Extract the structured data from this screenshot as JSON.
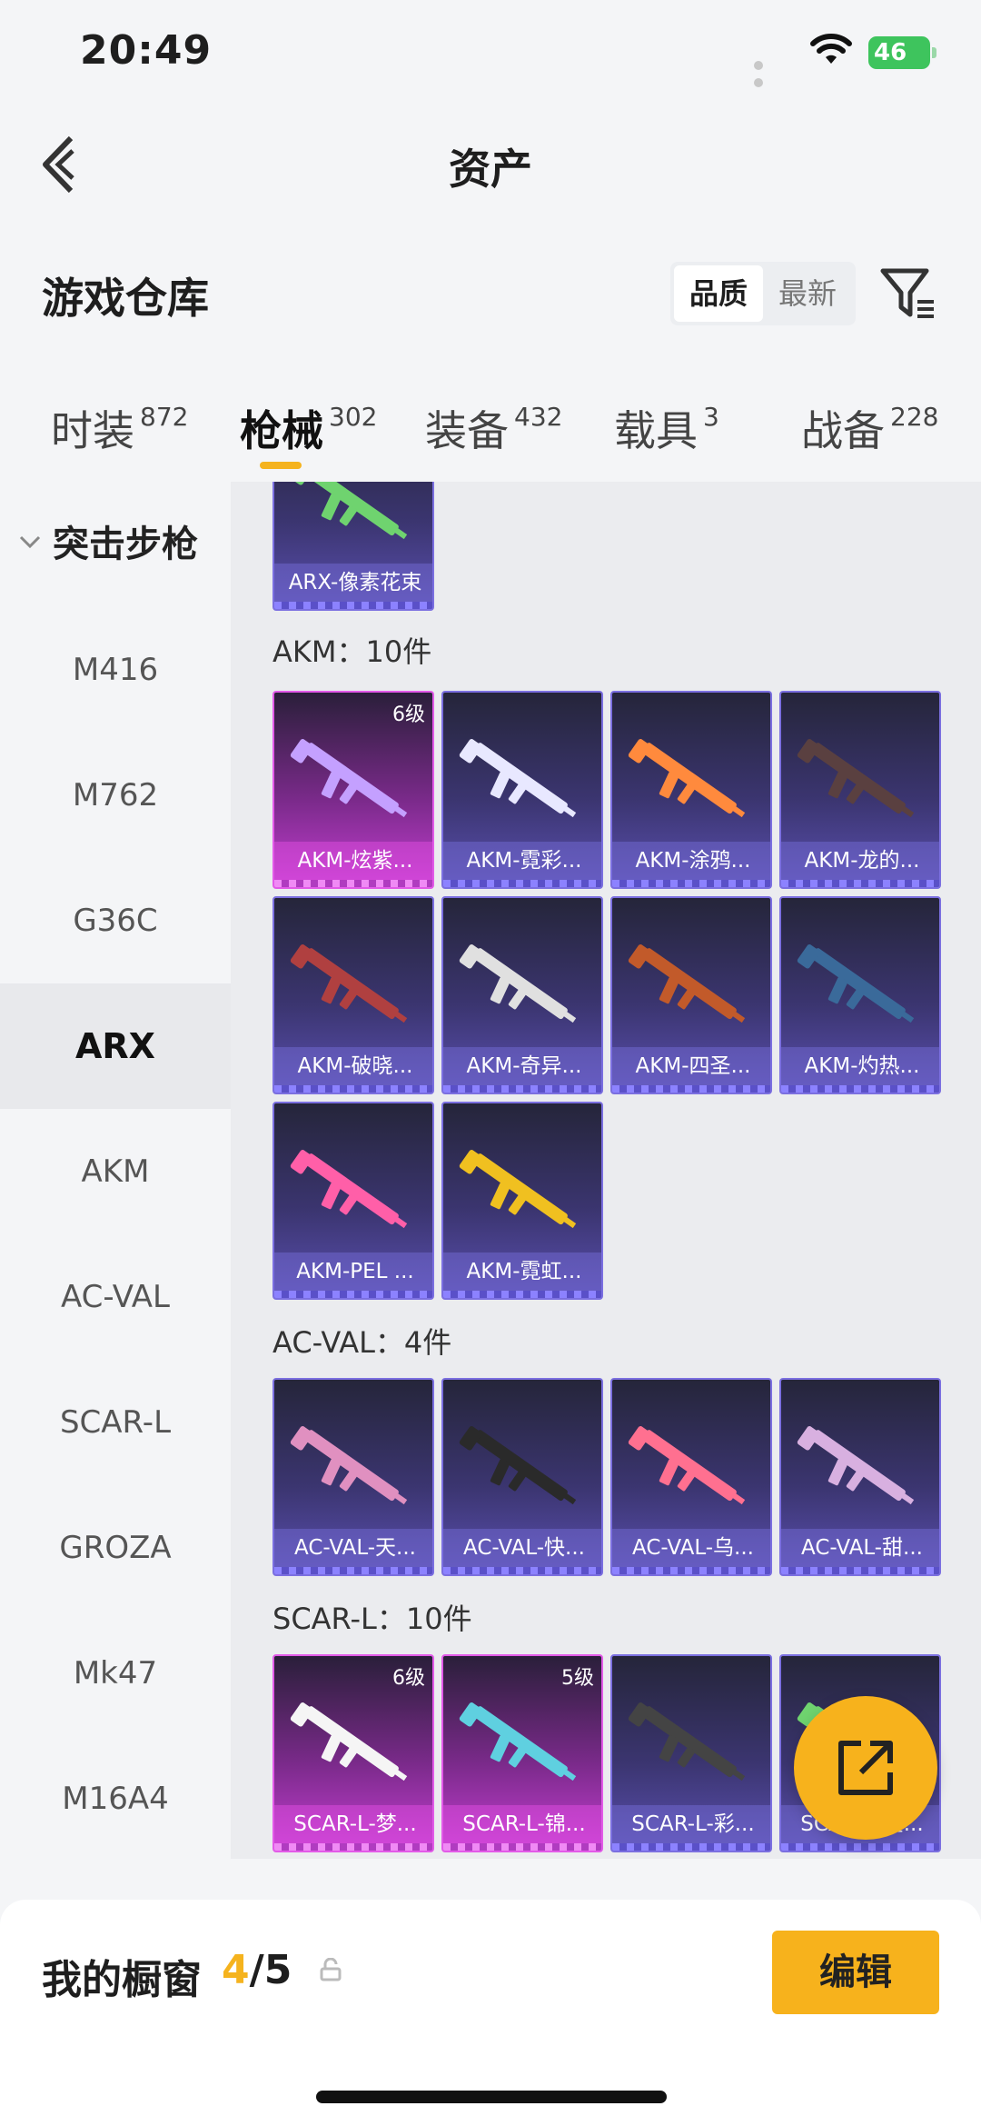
{
  "status_bar": {
    "time": "20:49",
    "battery": "46"
  },
  "nav": {
    "title": "资产"
  },
  "warehouse": {
    "title": "游戏仓库",
    "sort_options": [
      "品质",
      "最新"
    ]
  },
  "tabs": [
    {
      "label": "时装",
      "count": "872"
    },
    {
      "label": "枪械",
      "count": "302"
    },
    {
      "label": "装备",
      "count": "432"
    },
    {
      "label": "载具",
      "count": "3"
    },
    {
      "label": "战备",
      "count": "228"
    }
  ],
  "sidebar": {
    "group": "突击步枪",
    "items": [
      "M416",
      "M762",
      "G36C",
      "ARX",
      "AKM",
      "AC-VAL",
      "SCAR-L",
      "GROZA",
      "Mk47",
      "M16A4"
    ],
    "active": "ARX"
  },
  "groups": {
    "arx_top": {
      "items": [
        {
          "name": "ARX-像素花束"
        }
      ]
    },
    "akm": {
      "title": "AKM：10件",
      "items": [
        {
          "name": "AKM-炫紫...",
          "level": "6级"
        },
        {
          "name": "AKM-霓彩..."
        },
        {
          "name": "AKM-涂鸦..."
        },
        {
          "name": "AKM-龙的..."
        },
        {
          "name": "AKM-破晓..."
        },
        {
          "name": "AKM-奇异..."
        },
        {
          "name": "AKM-四圣..."
        },
        {
          "name": "AKM-灼热..."
        },
        {
          "name": "AKM-PEL ..."
        },
        {
          "name": "AKM-霓虹..."
        }
      ]
    },
    "acval": {
      "title": "AC-VAL：4件",
      "items": [
        {
          "name": "AC-VAL-天..."
        },
        {
          "name": "AC-VAL-快..."
        },
        {
          "name": "AC-VAL-乌..."
        },
        {
          "name": "AC-VAL-甜..."
        }
      ]
    },
    "scarl": {
      "title": "SCAR-L：10件",
      "items": [
        {
          "name": "SCAR-L-梦...",
          "level": "6级"
        },
        {
          "name": "SCAR-L-锦...",
          "level": "5级"
        },
        {
          "name": "SCAR-L-彩..."
        },
        {
          "name": "SCAR-L-星..."
        }
      ]
    }
  },
  "showcase": {
    "title": "我的橱窗",
    "current": "4",
    "total": "/5",
    "edit_label": "编辑"
  },
  "colors": {
    "accent": "#f7b21c",
    "card_purple": "#5a4fb0",
    "card_pink": "#c33ed0"
  }
}
